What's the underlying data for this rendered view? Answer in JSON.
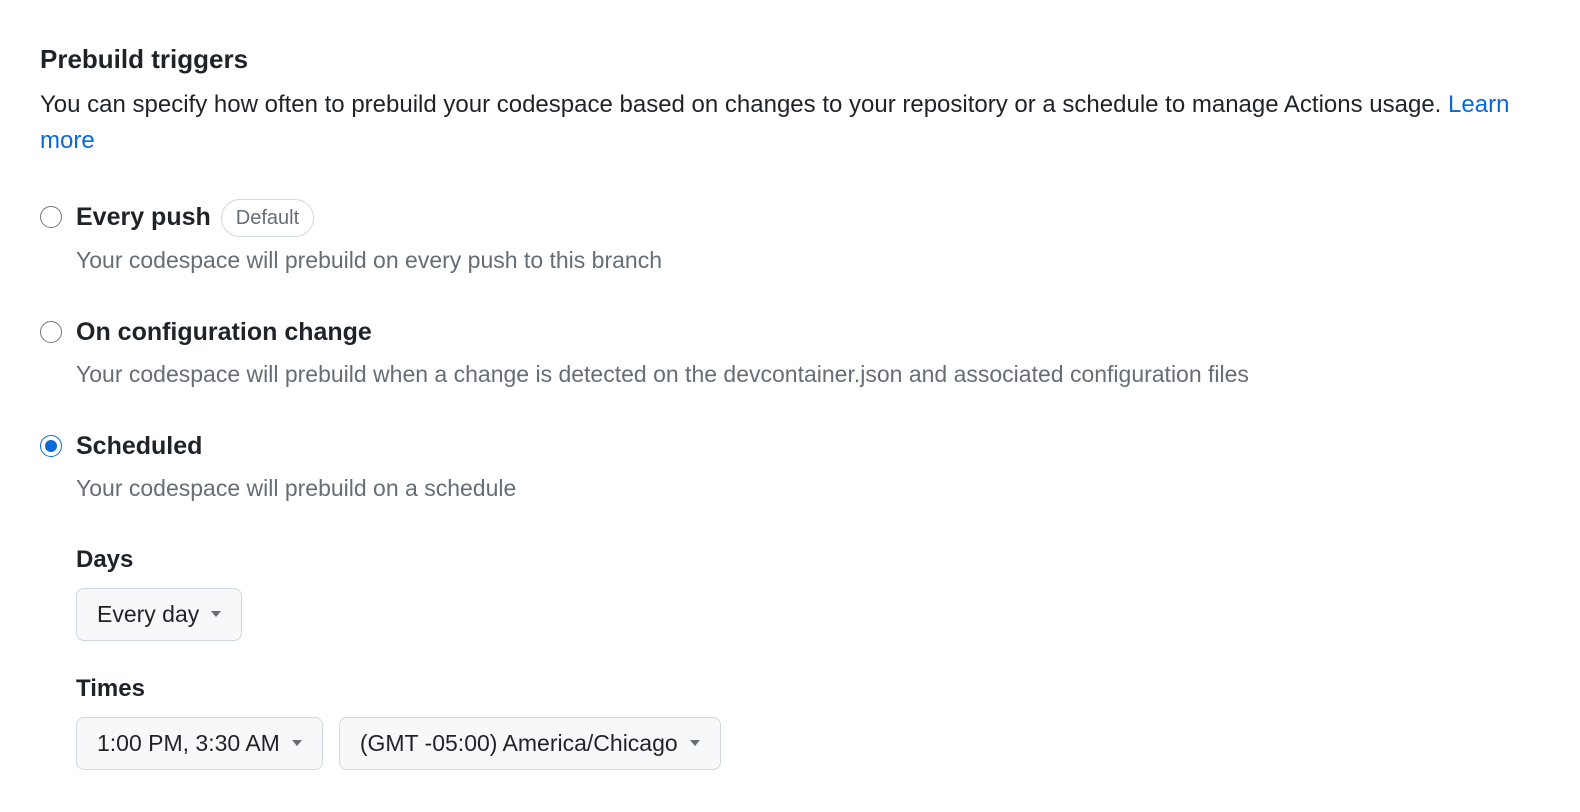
{
  "section": {
    "title": "Prebuild triggers",
    "description": "You can specify how often to prebuild your codespace based on changes to your repository or a schedule to manage Actions usage. ",
    "learn_more": "Learn more"
  },
  "options": {
    "every_push": {
      "label": "Every push",
      "badge": "Default",
      "description": "Your codespace will prebuild on every push to this branch"
    },
    "config_change": {
      "label": "On configuration change",
      "description": "Your codespace will prebuild when a change is detected on the devcontainer.json and associated configuration files"
    },
    "scheduled": {
      "label": "Scheduled",
      "description": "Your codespace will prebuild on a schedule"
    }
  },
  "schedule": {
    "days_label": "Days",
    "days_value": "Every day",
    "times_label": "Times",
    "times_value": "1:00 PM, 3:30 AM",
    "timezone_value": "(GMT -05:00) America/Chicago"
  }
}
